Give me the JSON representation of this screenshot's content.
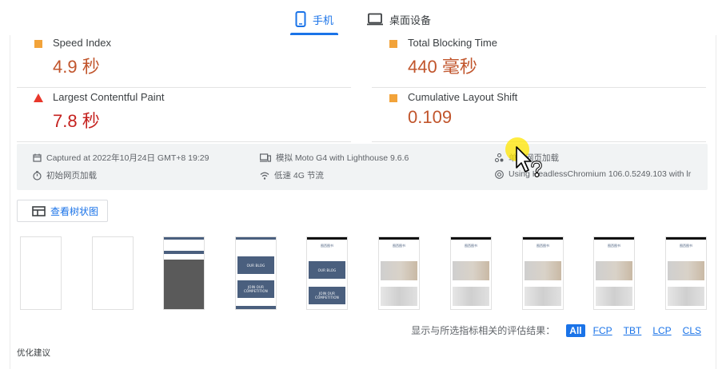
{
  "tabs": [
    {
      "label": "手机",
      "icon": "phone-icon",
      "active": true
    },
    {
      "label": "桌面设备",
      "icon": "laptop-icon",
      "active": false
    }
  ],
  "metrics": [
    {
      "label": "Speed Index",
      "value": "4.9 秒",
      "status": "average",
      "marker": "square"
    },
    {
      "label": "Total Blocking Time",
      "value": "440 毫秒",
      "status": "average",
      "marker": "square"
    },
    {
      "label": "Largest Contentful Paint",
      "value": "7.8 秒",
      "status": "fail",
      "marker": "triangle"
    },
    {
      "label": "Cumulative Layout Shift",
      "value": "0.109",
      "status": "average",
      "marker": "square"
    }
  ],
  "info": {
    "captured": "Captured at 2022年10月24日 GMT+8 19:29",
    "initial_load": "初始网页加载",
    "device": "模拟 Moto G4 with Lighthouse 9.6.6",
    "throttling": "低速 4G 节流",
    "single_load": "单次网页加载",
    "browser": "Using HeadlessChromium 106.0.5249.103 with lr"
  },
  "treemap_button": "查看树状图",
  "filmstrip": {
    "blog_label": "OUR BLOG",
    "join_label": "JOIN OUR COMPETITION",
    "site_name": "图西图书"
  },
  "filter": {
    "label": "显示与所选指标相关的评估结果：",
    "chips": [
      "All",
      "FCP",
      "TBT",
      "LCP",
      "CLS"
    ],
    "active": "All"
  },
  "section_title": "优化建议",
  "colors": {
    "accent": "#1a73e8",
    "average": "#f2a33a",
    "average_text": "#c1552c",
    "fail": "#e8372b",
    "fail_text": "#c5221f"
  }
}
